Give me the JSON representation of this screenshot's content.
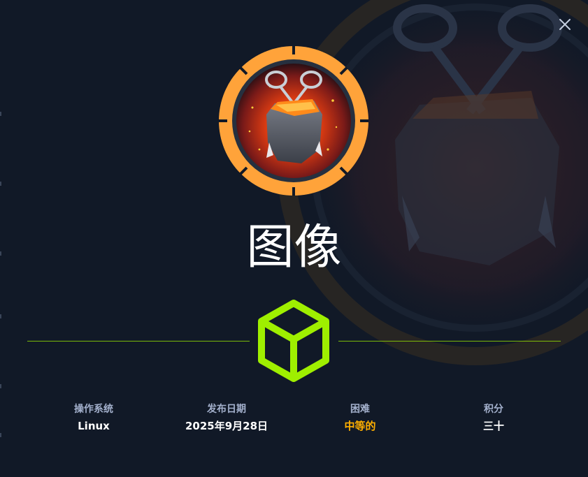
{
  "machine": {
    "name": "图像"
  },
  "close": {
    "icon": "close-icon"
  },
  "avatar": {
    "icon": "scissors-rock-fire-icon",
    "ring_color": "#ffa33a",
    "glow_color": "#ff6a00"
  },
  "os_icon": {
    "icon": "cube-icon",
    "color": "#9fef00"
  },
  "stats": [
    {
      "label": "操作系统",
      "value": "Linux"
    },
    {
      "label": "发布日期",
      "value": "2025年9月28日"
    },
    {
      "label": "困难",
      "value": "中等的",
      "color": "#ffaf00"
    },
    {
      "label": "积分",
      "value": "三十"
    }
  ],
  "colors": {
    "background": "#111927",
    "accent_green": "#9fef00",
    "difficulty_orange": "#ffaf00",
    "label": "#a4b1cd"
  }
}
